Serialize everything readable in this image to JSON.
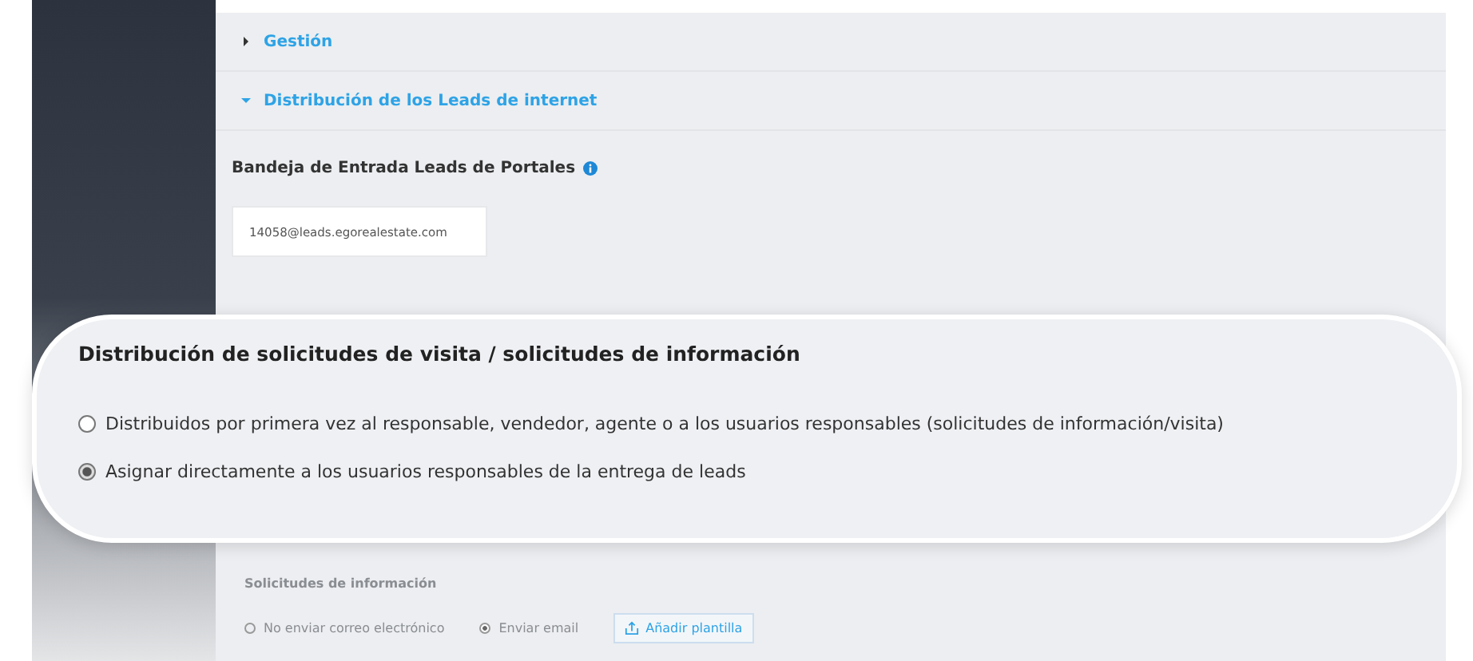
{
  "sections": [
    {
      "title": "Gestión",
      "expanded": false
    },
    {
      "title": "Distribución de los Leads de internet",
      "expanded": true
    }
  ],
  "inbox": {
    "label": "Bandeja de Entrada Leads de Portales",
    "value": "14058@leads.egorealestate.com"
  },
  "callout": {
    "title": "Distribución de solicitudes de visita / solicitudes de información",
    "options": [
      {
        "label": "Distribuidos por primera vez al responsable, vendedor, agente o a los usuarios responsables (solicitudes de información/visita)",
        "selected": false
      },
      {
        "label": "Asignar directamente a los usuarios responsables de la entrega de leads",
        "selected": true
      }
    ]
  },
  "info_requests": {
    "title": "Solicitudes de información",
    "options": [
      {
        "label": "No enviar correo electrónico",
        "selected": false
      },
      {
        "label": "Enviar email",
        "selected": true
      }
    ],
    "template_button": "Añadir plantilla"
  }
}
